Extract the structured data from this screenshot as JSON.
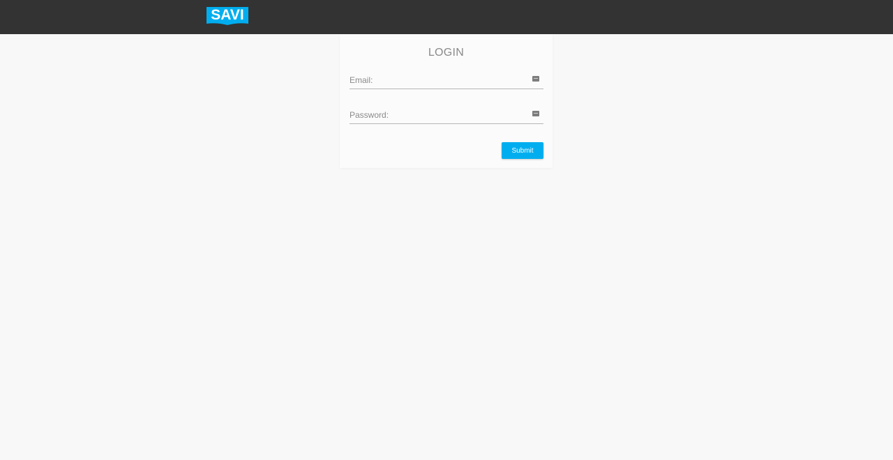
{
  "header": {
    "logo_text": "SAVI",
    "logo_color": "#00aeef",
    "background": "#333333"
  },
  "login": {
    "title": "LOGIN",
    "email": {
      "placeholder": "Email:",
      "value": "",
      "icon": "keyboard-icon"
    },
    "password": {
      "placeholder": "Password:",
      "value": "",
      "icon": "keyboard-icon"
    },
    "submit_label": "Submit",
    "accent": "#00aeef"
  }
}
